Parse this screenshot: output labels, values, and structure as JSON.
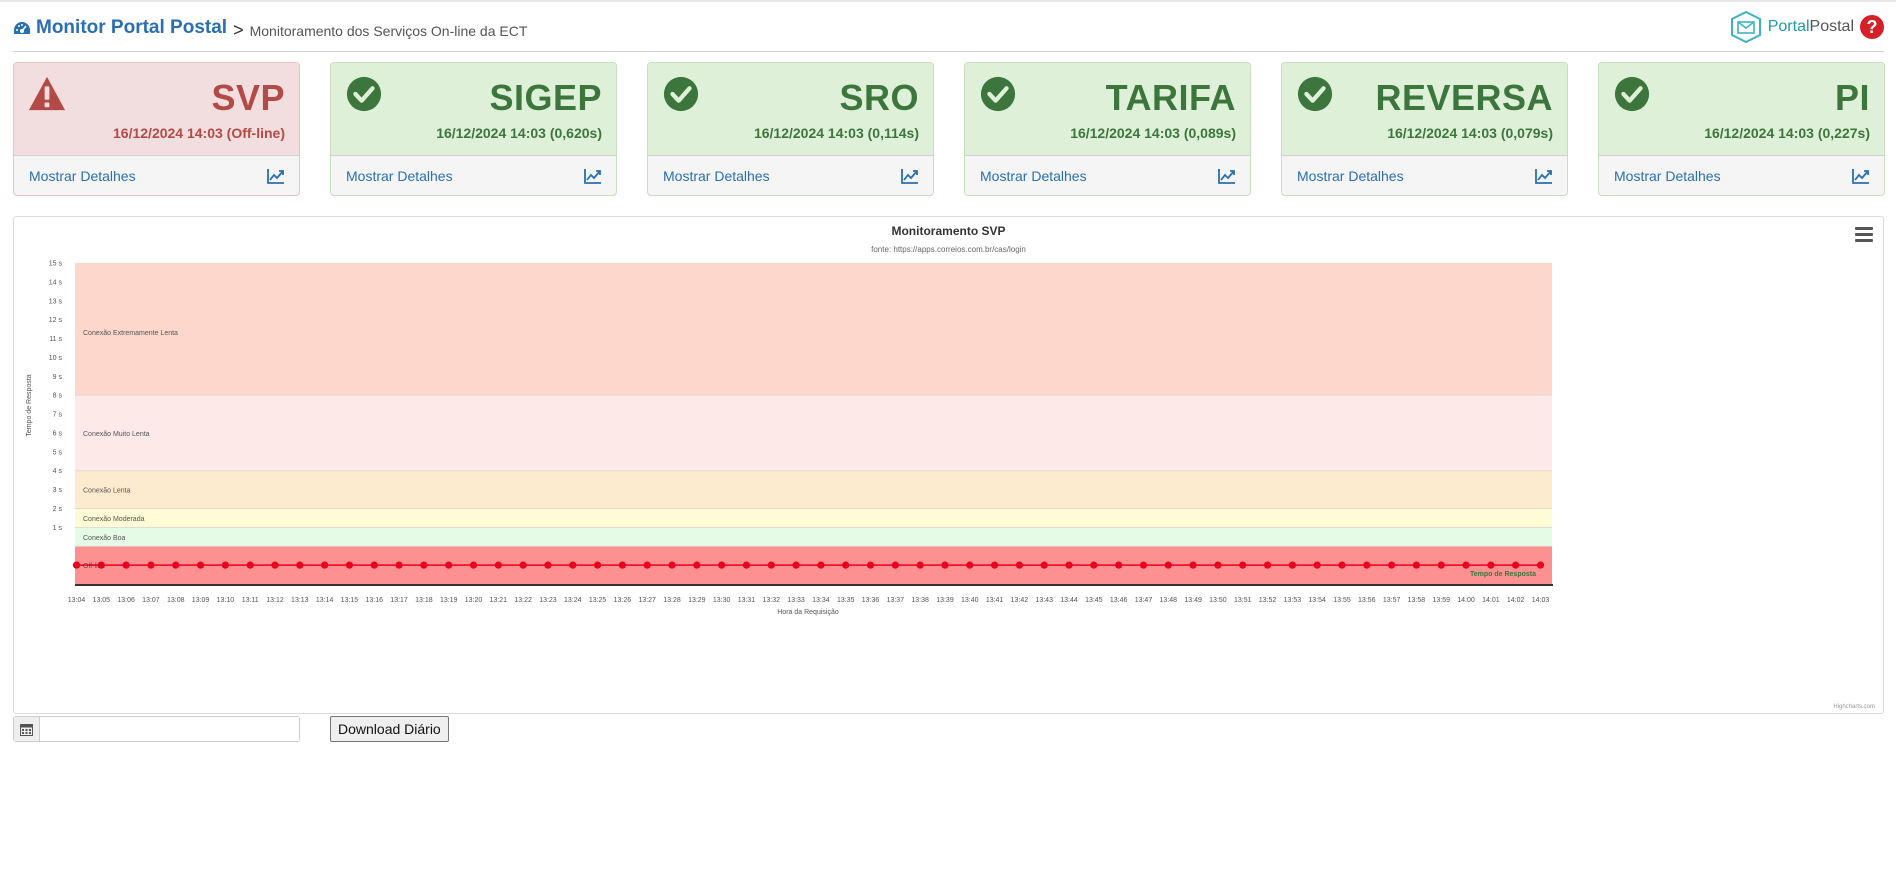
{
  "header": {
    "title": "Monitor Portal Postal",
    "separator": ">",
    "subtitle": "Monitoramento dos Serviços On-line da ECT",
    "logo_part1": "Portal",
    "logo_part2": "Postal",
    "help_label": "?"
  },
  "cards": [
    {
      "name": "SVP",
      "status": "16/12/2024 14:03 (Off-line)",
      "state": "error",
      "link": "Mostrar Detalhes"
    },
    {
      "name": "SIGEP",
      "status": "16/12/2024 14:03 (0,620s)",
      "state": "ok",
      "link": "Mostrar Detalhes"
    },
    {
      "name": "SRO",
      "status": "16/12/2024 14:03 (0,114s)",
      "state": "ok",
      "link": "Mostrar Detalhes"
    },
    {
      "name": "TARIFA",
      "status": "16/12/2024 14:03 (0,089s)",
      "state": "ok",
      "link": "Mostrar Detalhes"
    },
    {
      "name": "REVERSA",
      "status": "16/12/2024 14:03 (0,079s)",
      "state": "ok",
      "link": "Mostrar Detalhes"
    },
    {
      "name": "PI",
      "status": "16/12/2024 14:03 (0,227s)",
      "state": "ok",
      "link": "Mostrar Detalhes"
    }
  ],
  "colors": {
    "ok_text": "#3c763d",
    "ok_bg": "#dff0d8",
    "error_text": "#b24a48",
    "error_bg": "#f2dede",
    "link": "#2a6fb0",
    "series": "#e8001c"
  },
  "chart_data": {
    "type": "line",
    "title": "Monitoramento SVP",
    "subtitle": "fonte: https://apps.correios.com.br/cas/login",
    "xlabel": "Hora da Requisição",
    "ylabel": "Tempo de Resposta",
    "ylim": [
      -2,
      15
    ],
    "yticks": [
      1,
      2,
      3,
      4,
      5,
      6,
      7,
      8,
      9,
      10,
      11,
      12,
      13,
      14,
      15
    ],
    "ytick_suffix": " s",
    "x": [
      "13:04",
      "13:05",
      "13:06",
      "13:07",
      "13:08",
      "13:09",
      "13:10",
      "13:11",
      "13:12",
      "13:13",
      "13:14",
      "13:15",
      "13:16",
      "13:17",
      "13:18",
      "13:19",
      "13:20",
      "13:21",
      "13:22",
      "13:23",
      "13:24",
      "13:25",
      "13:26",
      "13:27",
      "13:28",
      "13:29",
      "13:30",
      "13:31",
      "13:32",
      "13:33",
      "13:34",
      "13:35",
      "13:36",
      "13:37",
      "13:38",
      "13:39",
      "13:40",
      "13:41",
      "13:42",
      "13:43",
      "13:44",
      "13:45",
      "13:46",
      "13:47",
      "13:48",
      "13:49",
      "13:50",
      "13:51",
      "13:52",
      "13:53",
      "13:54",
      "13:55",
      "13:56",
      "13:57",
      "13:58",
      "13:59",
      "14:00",
      "14:01",
      "14:02",
      "14:03"
    ],
    "series": [
      {
        "name": "Tempo de Resposta",
        "values": [
          -1,
          -1,
          -1,
          -1,
          -1,
          -1,
          -1,
          -1,
          -1,
          -1,
          -1,
          -1,
          -1,
          -1,
          -1,
          -1,
          -1,
          -1,
          -1,
          -1,
          -1,
          -1,
          -1,
          -1,
          -1,
          -1,
          -1,
          -1,
          -1,
          -1,
          -1,
          -1,
          -1,
          -1,
          -1,
          -1,
          -1,
          -1,
          -1,
          -1,
          -1,
          -1,
          -1,
          -1,
          -1,
          -1,
          -1,
          -1,
          -1,
          -1,
          -1,
          -1,
          -1,
          -1,
          -1,
          -1,
          -1,
          -1,
          -1,
          -1
        ]
      }
    ],
    "bands": [
      {
        "from": 8,
        "to": 15,
        "label": "Conexão Extremamente Lenta",
        "color": "#fdd6cc"
      },
      {
        "from": 4,
        "to": 8,
        "label": "Conexão Muito Lenta",
        "color": "#fdeae8"
      },
      {
        "from": 2,
        "to": 4,
        "label": "Conexão Lenta",
        "color": "#fdebd0"
      },
      {
        "from": 1,
        "to": 2,
        "label": "Conexão Moderada",
        "color": "#fdfcd6"
      },
      {
        "from": 0,
        "to": 1,
        "label": "Conexão Boa",
        "color": "#e5fbe6"
      },
      {
        "from": -2,
        "to": 0,
        "label": "Off-line",
        "color": "#fd9090"
      }
    ],
    "credits": "Highcharts.com"
  },
  "controls": {
    "date_value": "",
    "download_label": "Download Diário"
  }
}
